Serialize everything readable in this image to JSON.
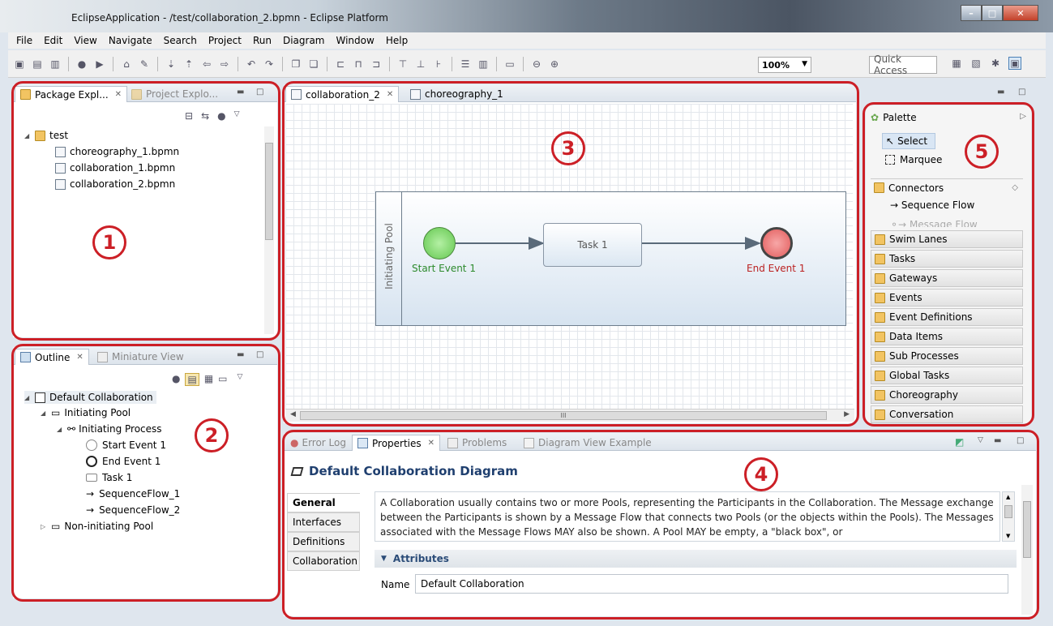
{
  "window": {
    "title": "EclipseApplication - /test/collaboration_2.bpmn - Eclipse Platform"
  },
  "menu": [
    "File",
    "Edit",
    "View",
    "Navigate",
    "Search",
    "Project",
    "Run",
    "Diagram",
    "Window",
    "Help"
  ],
  "toolbar": {
    "zoom": "100%",
    "quick_access": "Quick Access"
  },
  "package_explorer": {
    "tab_active": "Package Expl...",
    "tab_inactive": "Project Explo...",
    "project": "test",
    "files": [
      "choreography_1.bpmn",
      "collaboration_1.bpmn",
      "collaboration_2.bpmn"
    ]
  },
  "outline": {
    "tab_active": "Outline",
    "tab_inactive": "Miniature View",
    "root": "Default Collaboration",
    "pool": "Initiating Pool",
    "process": "Initiating Process",
    "items": [
      "Start Event 1",
      "End Event 1",
      "Task 1",
      "SequenceFlow_1",
      "SequenceFlow_2"
    ],
    "other_pool": "Non-initiating Pool"
  },
  "editor": {
    "tabs": [
      "collaboration_2",
      "choreography_1"
    ],
    "pool_label": "Initiating Pool",
    "start_event": "Start Event 1",
    "task": "Task 1",
    "end_event": "End Event 1"
  },
  "palette": {
    "title": "Palette",
    "tools": [
      "Select",
      "Marquee"
    ],
    "connectors": "Connectors",
    "connector_items": [
      "Sequence Flow",
      "Message Flow"
    ],
    "drawers": [
      "Swim Lanes",
      "Tasks",
      "Gateways",
      "Events",
      "Event Definitions",
      "Data Items",
      "Sub Processes",
      "Global Tasks",
      "Choreography",
      "Conversation"
    ]
  },
  "properties": {
    "tabs": [
      "Error Log",
      "Properties",
      "Problems",
      "Diagram View Example"
    ],
    "heading": "Default Collaboration Diagram",
    "side_tabs": [
      "General",
      "Interfaces",
      "Definitions",
      "Collaboration"
    ],
    "description": "A Collaboration usually contains two or more Pools, representing the Participants in the Collaboration. The Message exchange between the Participants is shown by a Message Flow that connects two Pools (or the objects within the Pools). The Messages associated with the Message Flows MAY also be shown. A Pool MAY be empty, a \"black box\", or",
    "attributes_label": "Attributes",
    "name_label": "Name",
    "name_value": "Default Collaboration"
  },
  "annotations": [
    "1",
    "2",
    "3",
    "4",
    "5"
  ],
  "colors": {
    "highlight": "#cc1f26",
    "start_event": "#63c74f",
    "end_event": "#e25b5b"
  }
}
